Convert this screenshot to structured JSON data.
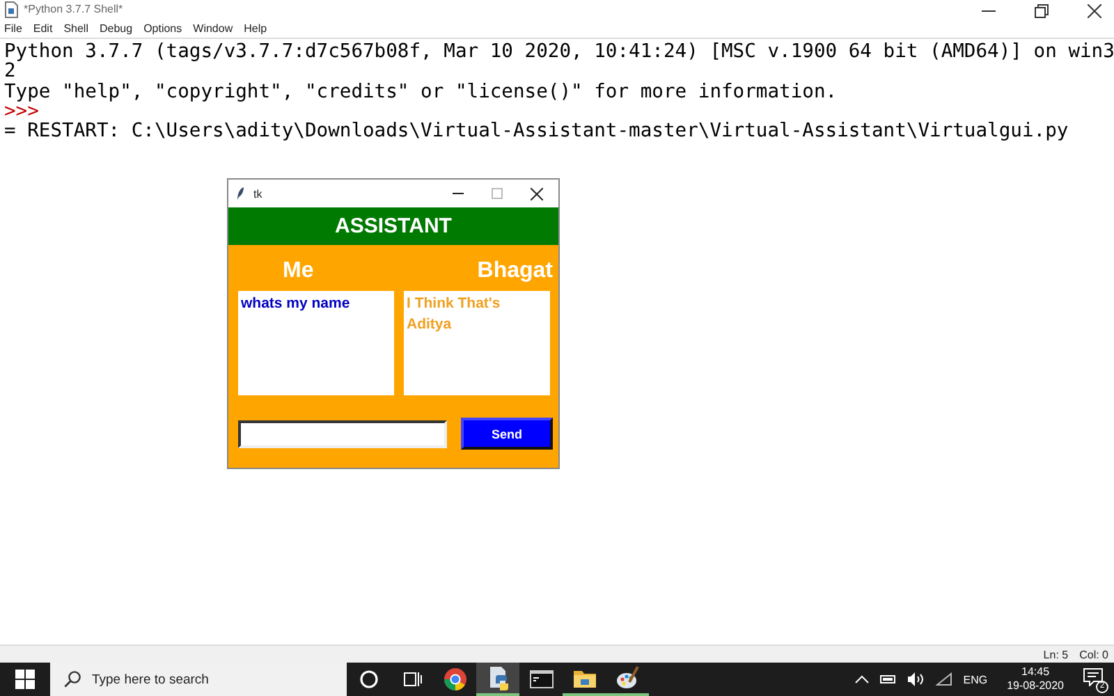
{
  "window": {
    "title": "*Python 3.7.7 Shell*",
    "menu": [
      "File",
      "Edit",
      "Shell",
      "Debug",
      "Options",
      "Window",
      "Help"
    ],
    "lines": [
      {
        "kind": "output",
        "text": "Python 3.7.7 (tags/v3.7.7:d7c567b08f, Mar 10 2020, 10:41:24) [MSC v.1900 64 bit (AMD64)] on win3"
      },
      {
        "kind": "output",
        "text": "2"
      },
      {
        "kind": "output",
        "text": "Type \"help\", \"copyright\", \"credits\" or \"license()\" for more information."
      },
      {
        "kind": "prompt",
        "text": ">>>"
      },
      {
        "kind": "output",
        "text": "= RESTART: C:\\Users\\adity\\Downloads\\Virtual-Assistant-master\\Virtual-Assistant\\Virtualgui.py"
      }
    ],
    "status_bar": [
      "Ln: 5",
      "Col: 0"
    ]
  },
  "tk_window": {
    "title": "tk",
    "header": "ASSISTANT",
    "user_label": "Me",
    "bot_label": "Bhagat",
    "user_message": "whats my name",
    "bot_message": "I Think That's Aditya",
    "send_button": "Send"
  },
  "taskbar": {
    "search": {
      "placeholder": "Type here to search"
    },
    "apps": [
      {
        "kind": "cortana",
        "running": false,
        "selected": false
      },
      {
        "kind": "taskview",
        "running": false,
        "selected": false
      },
      {
        "kind": "chrome",
        "running": false,
        "selected": false
      },
      {
        "kind": "python",
        "running": true,
        "selected": true
      },
      {
        "kind": "terminal",
        "running": false,
        "selected": false
      },
      {
        "kind": "folder",
        "running": true,
        "selected": false
      },
      {
        "kind": "paint",
        "running": true,
        "selected": false
      }
    ],
    "language": "ENG",
    "time": "14:45",
    "date": "19-08-2020",
    "notifications": "2"
  }
}
